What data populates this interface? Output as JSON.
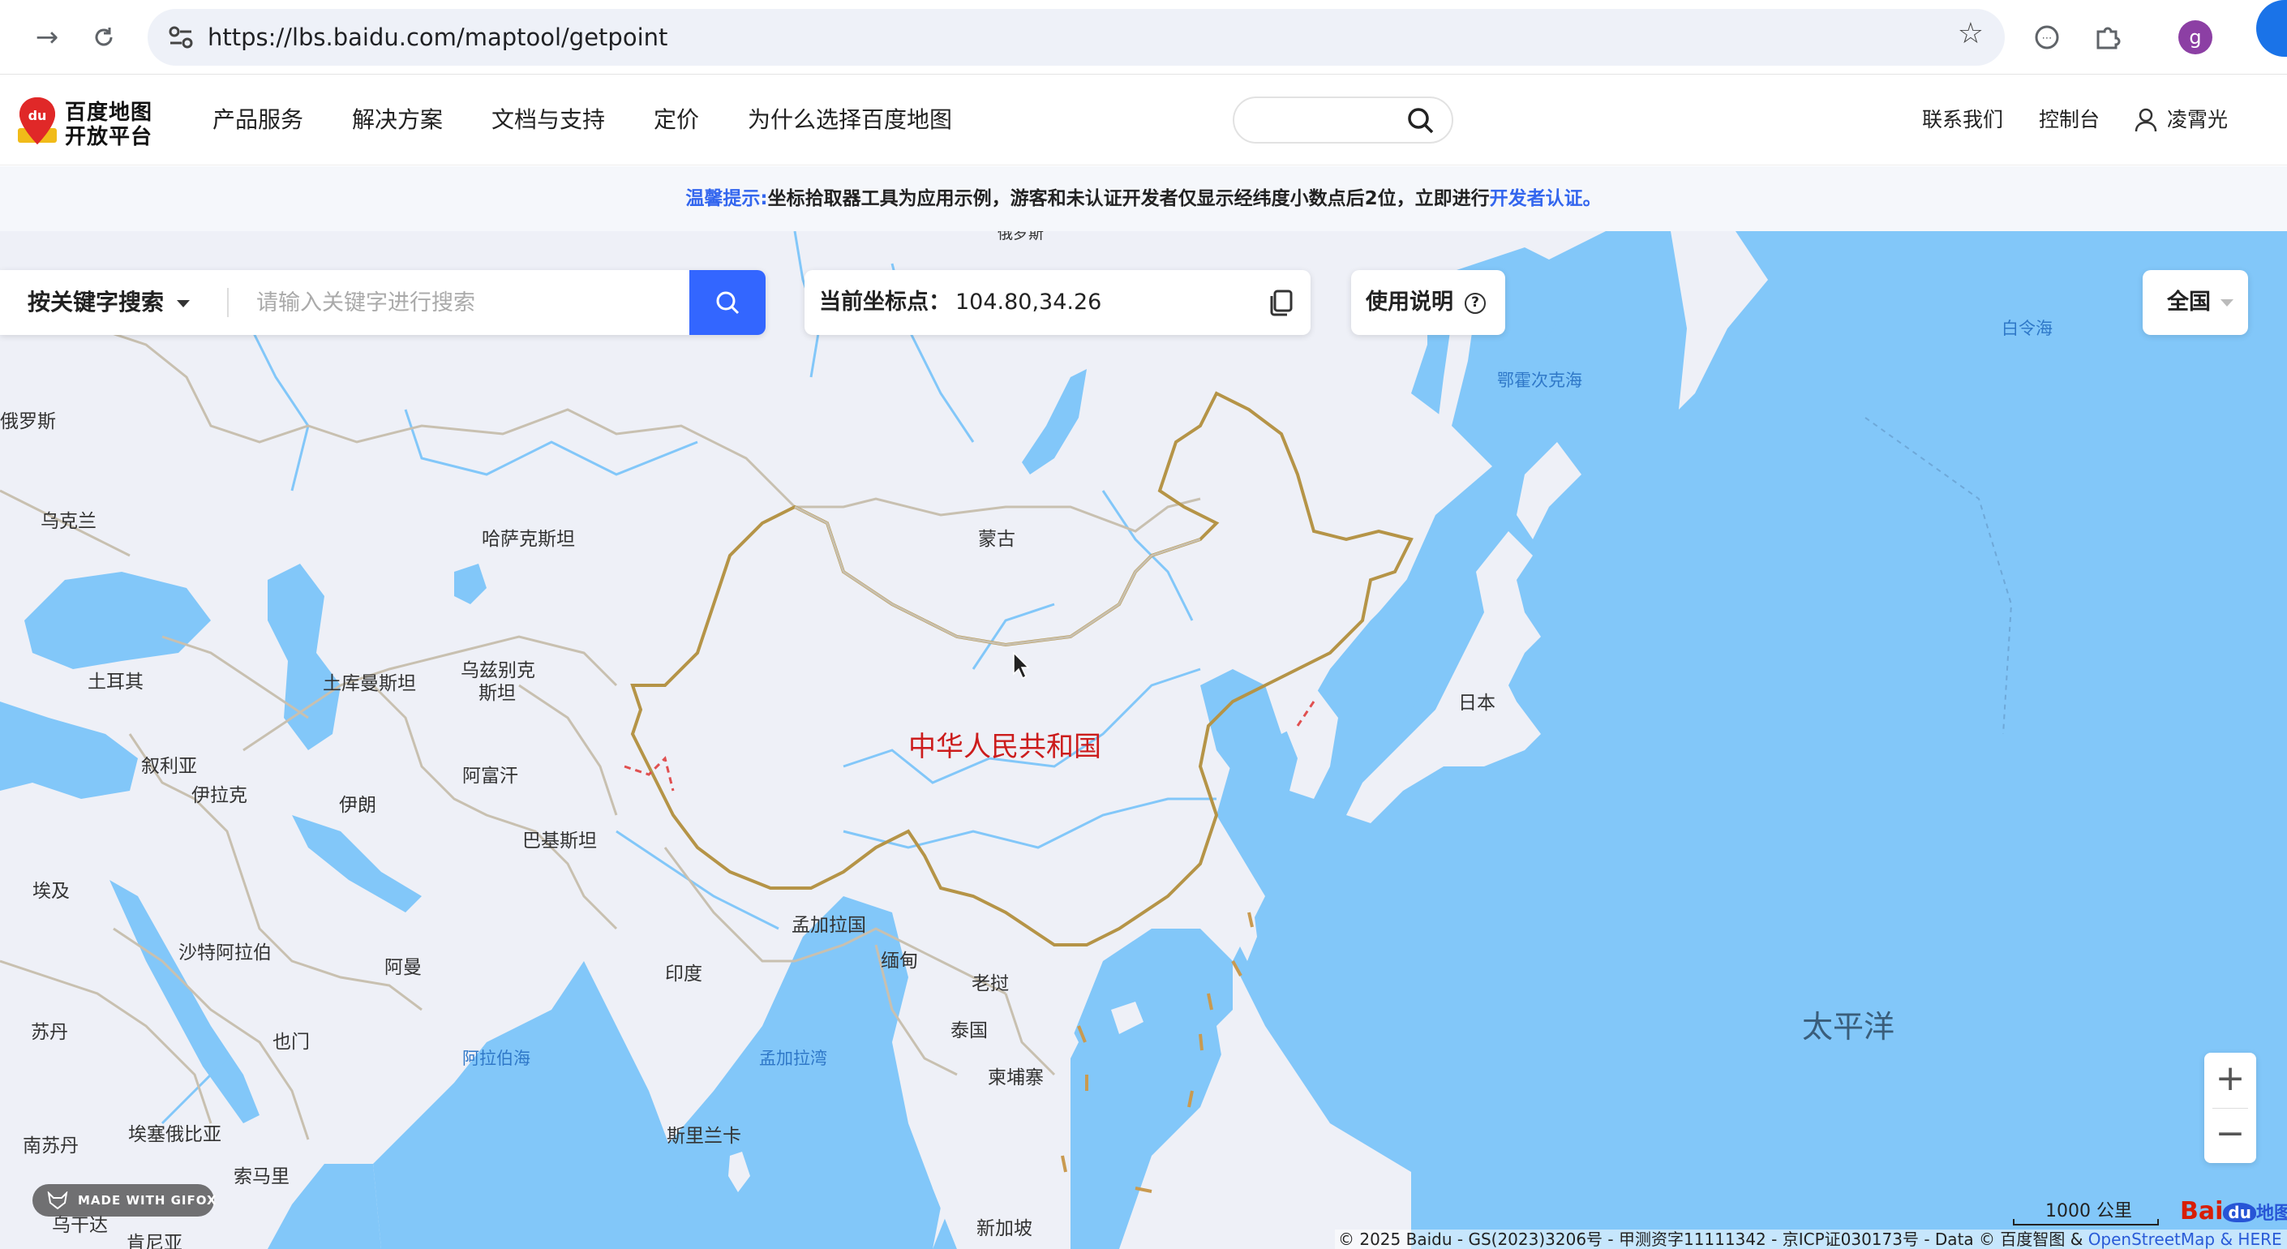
{
  "browser": {
    "url": "https://lbs.baidu.com/maptool/getpoint",
    "profile_initial": "g"
  },
  "header": {
    "logo_line1": "百度地图",
    "logo_line2": "开放平台",
    "nav": [
      "产品服务",
      "解决方案",
      "文档与支持",
      "定价",
      "为什么选择百度地图"
    ],
    "contact": "联系我们",
    "console": "控制台",
    "user": "凌霄光"
  },
  "notice": {
    "label": "温馨提示:",
    "text": "坐标拾取器工具为应用示例，游客和未认证开发者仅显示经纬度小数点后2位，立即进行",
    "link": "开发者认证",
    "end": "。"
  },
  "search": {
    "mode": "按关键字搜索",
    "placeholder": "请输入关键字进行搜索"
  },
  "coords": {
    "label": "当前坐标点：",
    "value": "104.80,34.26"
  },
  "help": {
    "label": "使用说明",
    "q": "?"
  },
  "region": {
    "label": "全国"
  },
  "zoom": {
    "in": "+",
    "out": "−"
  },
  "map_labels": {
    "russia": "俄罗斯",
    "ukraine": "乌克兰",
    "kazakhstan": "哈萨克斯坦",
    "mongolia": "蒙古",
    "turkey": "土耳其",
    "turkmenistan": "土库曼斯坦",
    "uzbekistan_1": "乌兹别克",
    "uzbekistan_2": "斯坦",
    "china": "中华人民共和国",
    "japan": "日本",
    "syria": "叙利亚",
    "iraq": "伊拉克",
    "iran": "伊朗",
    "afghanistan": "阿富汗",
    "pakistan": "巴基斯坦",
    "egypt": "埃及",
    "saudi": "沙特阿拉伯",
    "oman": "阿曼",
    "india": "印度",
    "bangladesh": "孟加拉国",
    "myanmar": "缅甸",
    "laos": "老挝",
    "thailand": "泰国",
    "cambodia": "柬埔寨",
    "sudan": "苏丹",
    "yemen": "也门",
    "arabian_sea": "阿拉伯海",
    "bay_of_bengal": "孟加拉湾",
    "south_sudan": "南苏丹",
    "ethiopia": "埃塞俄比亚",
    "srilanka": "斯里兰卡",
    "somalia": "索马里",
    "uganda": "乌干达",
    "kenya": "肯尼亚",
    "singapore": "新加坡",
    "okhotsk": "鄂霍次克海",
    "bering": "白令海",
    "pacific": "太平洋",
    "top_partial": "俄罗斯"
  },
  "gifox": "MADE WITH GIFOX",
  "scale": "1000 公里",
  "baidu_logo": {
    "bai": "Bai",
    "du": "du",
    "zh": "地图"
  },
  "copyright": {
    "text": "© 2025 Baidu - GS(2023)3206号 - 甲测资字11111342 - 京ICP证030173号 - Data © 百度智图 & ",
    "osm": "OpenStreetMap",
    "end": " & HERE"
  },
  "colors": {
    "sea": "#82c7f9",
    "land": "#eef0f7",
    "china_border": "#b59447",
    "accent": "#3366ff"
  }
}
